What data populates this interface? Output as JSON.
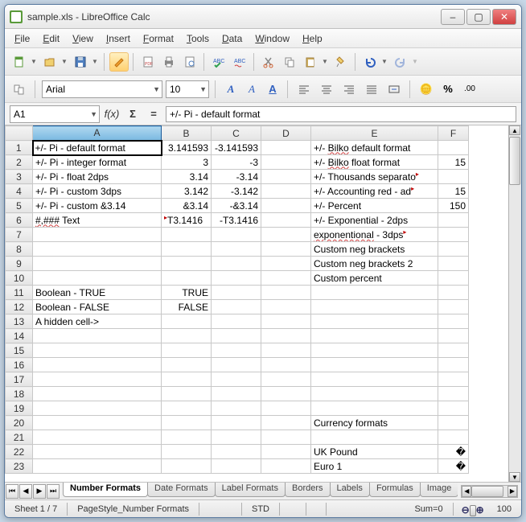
{
  "window": {
    "title": "sample.xls - LibreOffice Calc"
  },
  "menu": [
    "File",
    "Edit",
    "View",
    "Insert",
    "Format",
    "Tools",
    "Data",
    "Window",
    "Help"
  ],
  "font": {
    "name": "Arial",
    "size": "10"
  },
  "namebox": "A1",
  "formula": "+/- Pi - default format",
  "columns": [
    "A",
    "B",
    "C",
    "D",
    "E",
    "F"
  ],
  "rows": [
    {
      "n": 1,
      "A": "+/- Pi - default format",
      "B": "3.141593",
      "C": "-3.141593",
      "D": "",
      "E": "+/- Bilko default format",
      "F": "",
      "sel": true,
      "rightB": true,
      "rightC": true,
      "wavyE": "Bilko"
    },
    {
      "n": 2,
      "A": "+/- Pi - integer format",
      "B": "3",
      "C": "-3",
      "D": "",
      "E": "+/- Bilko float format",
      "F": "15",
      "rightB": true,
      "rightC": true,
      "rightF": true,
      "wavyE": "Bilko"
    },
    {
      "n": 3,
      "A": "+/- Pi - float 2dps",
      "B": "3.14",
      "C": "-3.14",
      "D": "",
      "E": "+/- Thousands separato",
      "F": "",
      "rightB": true,
      "rightC": true,
      "triE": true
    },
    {
      "n": 4,
      "A": "+/- Pi - custom 3dps",
      "B": "3.142",
      "C": "-3.142",
      "D": "",
      "E": "+/- Accounting red - ad",
      "F": "15",
      "rightB": true,
      "rightC": true,
      "rightF": true,
      "triE": true
    },
    {
      "n": 5,
      "A": "+/- Pi - custom &3.14",
      "B": "&3.14",
      "C": "-&3.14",
      "D": "",
      "E": "+/- Percent",
      "F": "150",
      "rightB": true,
      "rightC": true,
      "rightF": true
    },
    {
      "n": 6,
      "A": "#,### Text",
      "B": "T3.1416",
      "C": "-T3.1416",
      "D": "",
      "E": "+/- Exponential - 2dps",
      "F": "",
      "triB": true,
      "rightC": true,
      "wavyA": "#,###"
    },
    {
      "n": 7,
      "A": "",
      "B": "",
      "C": "",
      "D": "",
      "E": "exponentional - 3dps",
      "F": "",
      "wavyE": "exponentional",
      "triE": true
    },
    {
      "n": 8,
      "A": "",
      "B": "",
      "C": "",
      "D": "",
      "E": "Custom neg brackets",
      "F": ""
    },
    {
      "n": 9,
      "A": "",
      "B": "",
      "C": "",
      "D": "",
      "E": "Custom neg brackets 2",
      "F": ""
    },
    {
      "n": 10,
      "A": "",
      "B": "",
      "C": "",
      "D": "",
      "E": "Custom percent",
      "F": ""
    },
    {
      "n": 11,
      "A": "Boolean - TRUE",
      "B": "TRUE",
      "C": "",
      "D": "",
      "E": "",
      "F": "",
      "rightB": true
    },
    {
      "n": 12,
      "A": "Boolean - FALSE",
      "B": "FALSE",
      "C": "",
      "D": "",
      "E": "",
      "F": "",
      "rightB": true
    },
    {
      "n": 13,
      "A": "A hidden cell->",
      "B": "",
      "C": "",
      "D": "",
      "E": "",
      "F": ""
    },
    {
      "n": 14,
      "A": "",
      "B": "",
      "C": "",
      "D": "",
      "E": "",
      "F": ""
    },
    {
      "n": 15,
      "A": "",
      "B": "",
      "C": "",
      "D": "",
      "E": "",
      "F": ""
    },
    {
      "n": 16,
      "A": "",
      "B": "",
      "C": "",
      "D": "",
      "E": "",
      "F": ""
    },
    {
      "n": 17,
      "A": "",
      "B": "",
      "C": "",
      "D": "",
      "E": "",
      "F": ""
    },
    {
      "n": 18,
      "A": "",
      "B": "",
      "C": "",
      "D": "",
      "E": "",
      "F": ""
    },
    {
      "n": 19,
      "A": "",
      "B": "",
      "C": "",
      "D": "",
      "E": "",
      "F": ""
    },
    {
      "n": 20,
      "A": "",
      "B": "",
      "C": "",
      "D": "",
      "E": "Currency formats",
      "F": ""
    },
    {
      "n": 21,
      "A": "",
      "B": "",
      "C": "",
      "D": "",
      "E": "",
      "F": ""
    },
    {
      "n": 22,
      "A": "",
      "B": "",
      "C": "",
      "D": "",
      "E": "UK Pound",
      "F": "�",
      "rightF": true
    },
    {
      "n": 23,
      "A": "",
      "B": "",
      "C": "",
      "D": "",
      "E": "Euro 1",
      "F": "�",
      "rightF": true
    }
  ],
  "tabs": [
    "Number Formats",
    "Date Formats",
    "Label Formats",
    "Borders",
    "Labels",
    "Formulas",
    "Image"
  ],
  "active_tab": 0,
  "status": {
    "sheet": "Sheet 1 / 7",
    "pagestyle": "PageStyle_Number Formats",
    "std": "STD",
    "sum": "Sum=0",
    "zoom": "100"
  }
}
